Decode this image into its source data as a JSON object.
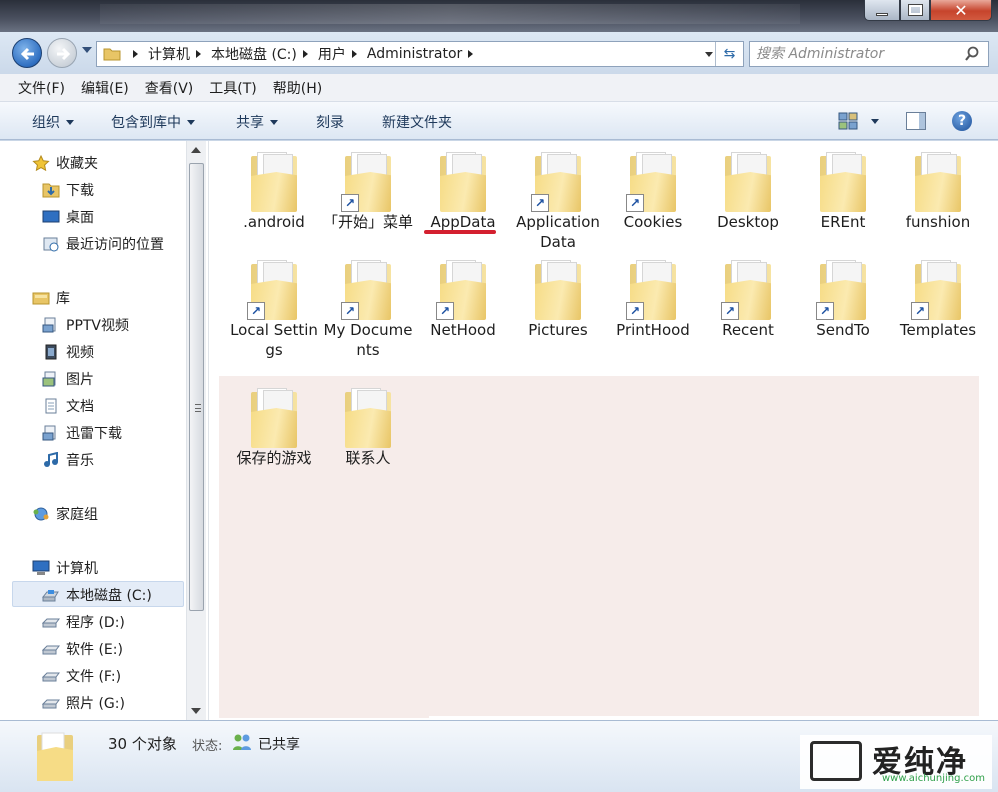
{
  "address": {
    "crumbs": [
      "计算机",
      "本地磁盘 (C:)",
      "用户",
      "Administrator"
    ]
  },
  "search": {
    "placeholder": "搜索 Administrator"
  },
  "menu": [
    "文件(F)",
    "编辑(E)",
    "查看(V)",
    "工具(T)",
    "帮助(H)"
  ],
  "toolbar": {
    "organize": "组织",
    "include": "包含到库中",
    "share": "共享",
    "burn": "刻录",
    "new_folder": "新建文件夹"
  },
  "nav": {
    "favorites": "收藏夹",
    "downloads": "下载",
    "desktop": "桌面",
    "recent": "最近访问的位置",
    "libraries": "库",
    "pptv": "PPTV视频",
    "videos": "视频",
    "pictures": "图片",
    "documents": "文档",
    "xunlei": "迅雷下载",
    "music": "音乐",
    "homegroup": "家庭组",
    "computer": "计算机",
    "drive_c": "本地磁盘 (C:)",
    "drive_d": "程序 (D:)",
    "drive_e": "软件 (E:)",
    "drive_f": "文件 (F:)",
    "drive_g": "照片 (G:)"
  },
  "files": [
    {
      "name": ".android",
      "shortcut": false
    },
    {
      "name": "「开始」菜单",
      "shortcut": true
    },
    {
      "name": "AppData",
      "shortcut": false
    },
    {
      "name": "Application Data",
      "shortcut": true
    },
    {
      "name": "Cookies",
      "shortcut": true
    },
    {
      "name": "Desktop",
      "shortcut": false
    },
    {
      "name": "EREnt",
      "shortcut": false
    },
    {
      "name": "funshion",
      "shortcut": false
    },
    {
      "name": "Local Settings",
      "shortcut": true
    },
    {
      "name": "My Documents",
      "shortcut": true
    },
    {
      "name": "NetHood",
      "shortcut": true
    },
    {
      "name": "Pictures",
      "shortcut": false
    },
    {
      "name": "PrintHood",
      "shortcut": true
    },
    {
      "name": "Recent",
      "shortcut": true
    },
    {
      "name": "SendTo",
      "shortcut": true
    },
    {
      "name": "Templates",
      "shortcut": true
    },
    {
      "name": "保存的游戏",
      "shortcut": false
    },
    {
      "name": "联系人",
      "shortcut": false
    }
  ],
  "details": {
    "count": "30 个对象",
    "state_label": "状态:",
    "state_value": "已共享"
  },
  "watermark": {
    "brand": "爱纯净",
    "url": "www.aichunjing.com"
  },
  "colors": {
    "folder": "#f6dc86",
    "highlight_underline": "#d4202f",
    "window_frame": "#c9d6e6"
  }
}
